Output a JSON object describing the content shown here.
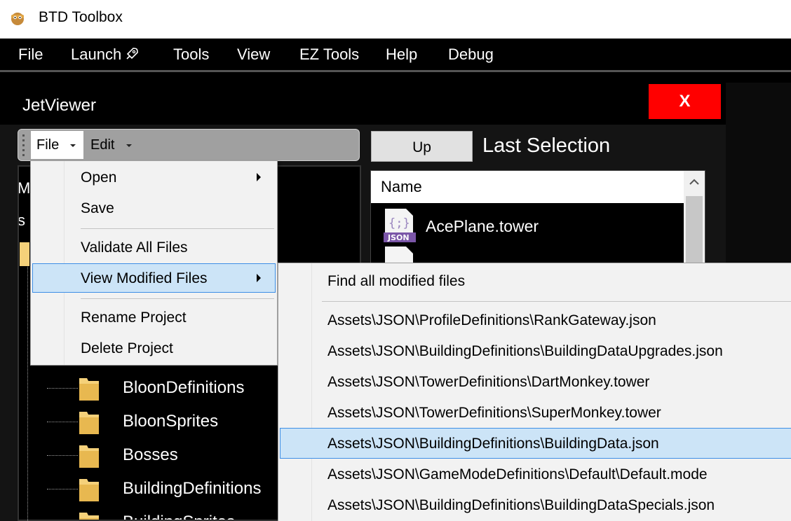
{
  "window": {
    "title": "BTD Toolbox"
  },
  "menubar": {
    "items": [
      {
        "label": "File"
      },
      {
        "label": "Launch"
      },
      {
        "label": "Tools"
      },
      {
        "label": "View"
      },
      {
        "label": "EZ Tools"
      },
      {
        "label": "Help"
      },
      {
        "label": "Debug"
      }
    ]
  },
  "jetviewer": {
    "title": "JetViewer",
    "close_label": "X",
    "toolbar": {
      "file_label": "File",
      "edit_label": "Edit"
    },
    "tree": {
      "cut_labels": [
        "M",
        "s"
      ],
      "items": [
        {
          "label": "BloonDefinitions"
        },
        {
          "label": "BloonSprites"
        },
        {
          "label": "Bosses"
        },
        {
          "label": "BuildingDefinitions"
        },
        {
          "label": "BuildingSprites"
        }
      ]
    },
    "right_pane": {
      "up_label": "Up",
      "last_selection_label": "Last Selection",
      "list_header": "Name",
      "files": [
        {
          "label": "AcePlane.tower",
          "badge": "JSON",
          "glyph": "{;}"
        }
      ]
    }
  },
  "file_dropdown": {
    "items": [
      {
        "label": "Open"
      },
      {
        "label": "Save"
      },
      {
        "label": "Validate All Files"
      },
      {
        "label": "View Modified Files"
      },
      {
        "label": "Rename Project"
      },
      {
        "label": "Delete Project"
      }
    ]
  },
  "modified_submenu": {
    "items": [
      {
        "label": "Find all modified files"
      },
      {
        "label": "Assets\\JSON\\ProfileDefinitions\\RankGateway.json"
      },
      {
        "label": "Assets\\JSON\\BuildingDefinitions\\BuildingDataUpgrades.json"
      },
      {
        "label": "Assets\\JSON\\TowerDefinitions\\DartMonkey.tower"
      },
      {
        "label": "Assets\\JSON\\TowerDefinitions\\SuperMonkey.tower"
      },
      {
        "label": "Assets\\JSON\\BuildingDefinitions\\BuildingData.json"
      },
      {
        "label": "Assets\\JSON\\GameModeDefinitions\\Default\\Default.mode"
      },
      {
        "label": "Assets\\JSON\\BuildingDefinitions\\BuildingDataSpecials.json"
      }
    ]
  },
  "colors": {
    "accent_highlight": "#cce4f7",
    "accent_border": "#3d8ee6",
    "close_red": "#ff0000",
    "folder_yellow": "#f5d17a"
  }
}
